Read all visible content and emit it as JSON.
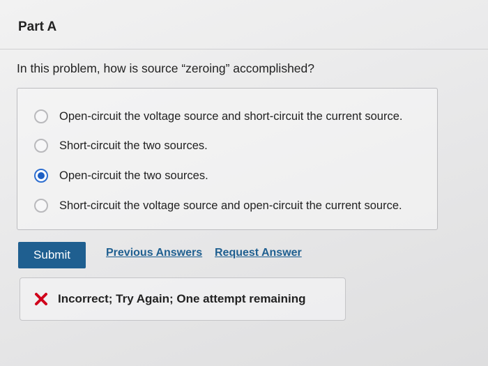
{
  "part": {
    "title": "Part A"
  },
  "question": {
    "text": "In this problem, how is source “zeroing” accomplished?"
  },
  "options": [
    {
      "label": "Open-circuit the voltage source and short-circuit the current source.",
      "selected": false
    },
    {
      "label": "Short-circuit the two sources.",
      "selected": false
    },
    {
      "label": "Open-circuit the two sources.",
      "selected": true
    },
    {
      "label": "Short-circuit the voltage source and open-circuit the current source.",
      "selected": false
    }
  ],
  "actions": {
    "submit_label": "Submit",
    "previous_answers_label": "Previous Answers",
    "request_answer_label": "Request Answer"
  },
  "feedback": {
    "icon": "x-icon",
    "text": "Incorrect; Try Again; One attempt remaining",
    "icon_color": "#d0021b"
  },
  "colors": {
    "accent": "#1f5f90",
    "radio_selected": "#1d5fc4"
  }
}
